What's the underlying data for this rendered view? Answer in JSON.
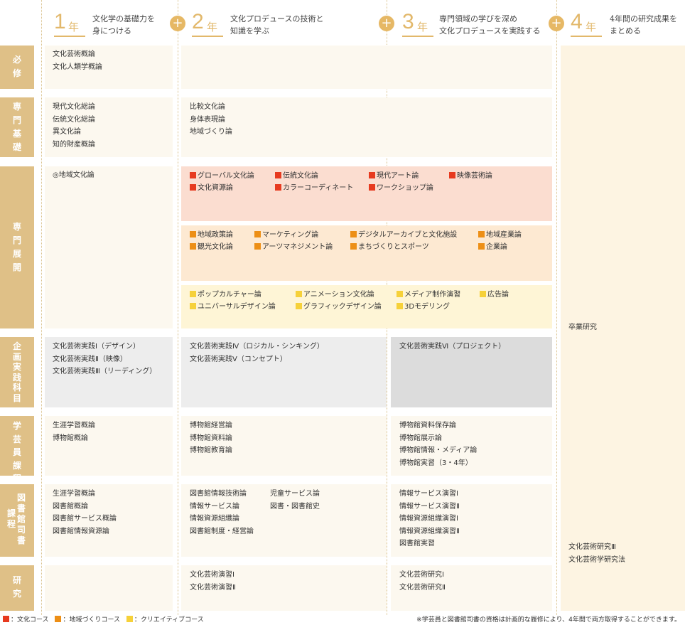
{
  "header": {
    "years": [
      {
        "num": "1",
        "unit": "年",
        "desc": [
          "文化学の基礎力を",
          "身につける"
        ]
      },
      {
        "num": "2",
        "unit": "年",
        "desc": [
          "文化プロデュースの技術と",
          "知識を学ぶ"
        ]
      },
      {
        "num": "3",
        "unit": "年",
        "desc": [
          "専門領域の学びを深め",
          "文化プロデュースを実践する"
        ]
      },
      {
        "num": "4",
        "unit": "年",
        "desc": [
          "4年間の研究成果を",
          "まとめる"
        ]
      }
    ],
    "plus": "+"
  },
  "rows": {
    "hisshu": {
      "label": "必修",
      "y1": [
        "文化芸術概論",
        "文化人類学概論"
      ]
    },
    "senmon_kiso": {
      "label": "専門基礎",
      "y1": [
        "現代文化総論",
        "伝統文化総論",
        "異文化論",
        "知的財産概論"
      ],
      "y2": [
        "比較文化論",
        "身体表現論",
        "地域づくり論"
      ]
    },
    "senmon_tenkai": {
      "label": "専門展開",
      "y1": [
        "◎地域文化論"
      ],
      "bunka": [
        "グローバル文化論",
        "伝統文化論",
        "現代アート論",
        "映像芸術論",
        "文化資源論",
        "カラーコーディネート",
        "ワークショップ論"
      ],
      "chiiki": [
        "地域政策論",
        "マーケティング論",
        "デジタルアーカイブと文化施設",
        "地域産業論",
        "観光文化論",
        "アーツマネジメント論",
        "まちづくりとスポーツ",
        "企業論"
      ],
      "creative": [
        "ポップカルチャー論",
        "アニメーション文化論",
        "メディア制作演習",
        "広告論",
        "ユニバーサルデザイン論",
        "グラフィックデザイン論",
        "3Dモデリング"
      ]
    },
    "kikaku": {
      "label": "企画実践科目",
      "y1": [
        "文化芸術実践Ⅰ（デザイン）",
        "文化芸術実践Ⅱ（映像）",
        "文化芸術実践Ⅲ（リーディング）"
      ],
      "y2": [
        "文化芸術実践Ⅳ（ロジカル・シンキング）",
        "文化芸術実践Ⅴ（コンセプト）"
      ],
      "y3": [
        "文化芸術実践Ⅵ（プロジェクト）"
      ]
    },
    "gakugeiin": {
      "label": "学芸員課程",
      "y1": [
        "生涯学習概論",
        "博物館概論"
      ],
      "y2": [
        "博物館経営論",
        "博物館資料論",
        "博物館教育論"
      ],
      "y3": [
        "博物館資料保存論",
        "博物館展示論",
        "博物館情報・メディア論",
        "博物館実習（3・4年）"
      ]
    },
    "toshokan": {
      "label_a": "課程",
      "label_b": "図書館司書",
      "y1": [
        "生涯学習概論",
        "図書館概論",
        "図書館サービス概論",
        "図書館情報資源論"
      ],
      "y2a": [
        "図書館情報技術論",
        "情報サービス論",
        "情報資源組織論",
        "図書館制度・経営論"
      ],
      "y2b": [
        "児童サービス論",
        "図書・図書館史"
      ],
      "y3": [
        "情報サービス演習Ⅰ",
        "情報サービス演習Ⅱ",
        "情報資源組織演習Ⅰ",
        "情報資源組織演習Ⅱ",
        "図書館実習"
      ]
    },
    "kenkyu": {
      "label": "研究",
      "y2": [
        "文化芸術演習Ⅰ",
        "文化芸術演習Ⅱ"
      ],
      "y3": [
        "文化芸術研究Ⅰ",
        "文化芸術研究Ⅱ"
      ]
    }
  },
  "year4": {
    "sotsugyo": "卒業研究",
    "bottom": [
      "文化芸術研究Ⅲ",
      "文化芸術学研究法"
    ]
  },
  "legend": [
    {
      "color": "red",
      "label": "：文化コース"
    },
    {
      "color": "orange",
      "label": "：地域づくりコース"
    },
    {
      "color": "yellow",
      "label": "：クリエイティブコース"
    }
  ],
  "note": "※学芸員と図書館司書の資格は計画的な履修により、4年間で両方取得することができます。",
  "colors": {
    "accent": "#e2b86b",
    "label_bg": "#dfc087",
    "bunka": "#e73a1f",
    "chiiki": "#ed8f16",
    "creative": "#f6d13a"
  }
}
